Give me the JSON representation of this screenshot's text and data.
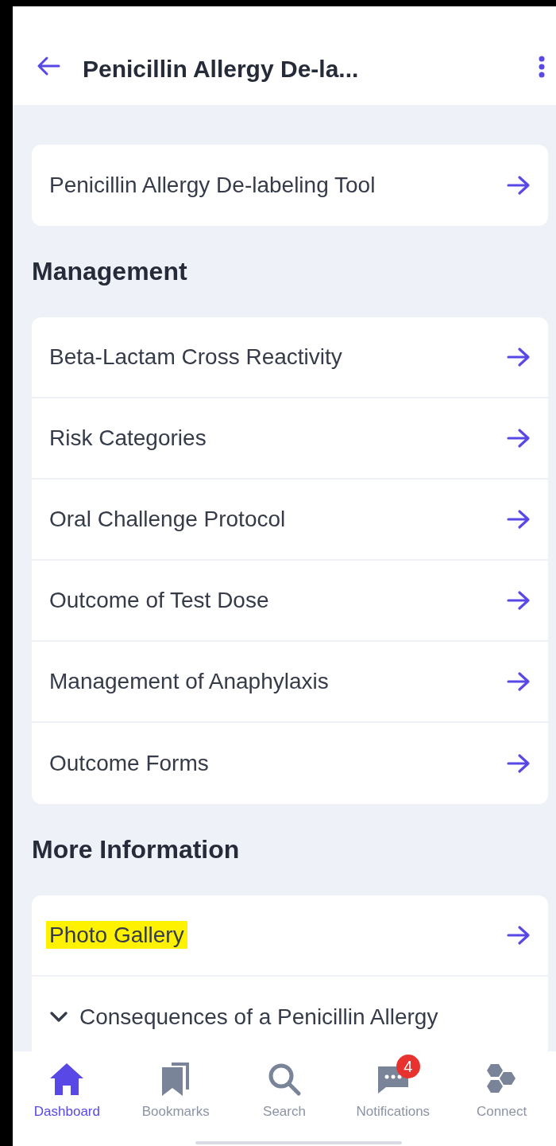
{
  "header": {
    "title": "Penicillin Allergy De-la..."
  },
  "sections": [
    {
      "items": [
        {
          "label": "Penicillin Allergy De-labeling Tool",
          "kind": "link",
          "highlighted": false
        }
      ]
    },
    {
      "heading": "Management",
      "items": [
        {
          "label": "Beta-Lactam Cross Reactivity",
          "kind": "link",
          "highlighted": false
        },
        {
          "label": "Risk Categories",
          "kind": "link",
          "highlighted": false
        },
        {
          "label": "Oral Challenge Protocol",
          "kind": "link",
          "highlighted": false
        },
        {
          "label": "Outcome of Test Dose",
          "kind": "link",
          "highlighted": false
        },
        {
          "label": "Management of Anaphylaxis",
          "kind": "link",
          "highlighted": false
        },
        {
          "label": "Outcome Forms",
          "kind": "link",
          "highlighted": false
        }
      ]
    },
    {
      "heading": "More Information",
      "items": [
        {
          "label": "Photo Gallery",
          "kind": "link",
          "highlighted": true
        },
        {
          "label": "Consequences of a Penicillin Allergy",
          "kind": "expander",
          "expanded": true,
          "highlighted": false
        }
      ]
    }
  ],
  "tabs": [
    {
      "label": "Dashboard",
      "selected": true
    },
    {
      "label": "Bookmarks",
      "selected": false
    },
    {
      "label": "Search",
      "selected": false
    },
    {
      "label": "Notifications",
      "selected": false,
      "badge": "4"
    },
    {
      "label": "Connect",
      "selected": false
    }
  ]
}
